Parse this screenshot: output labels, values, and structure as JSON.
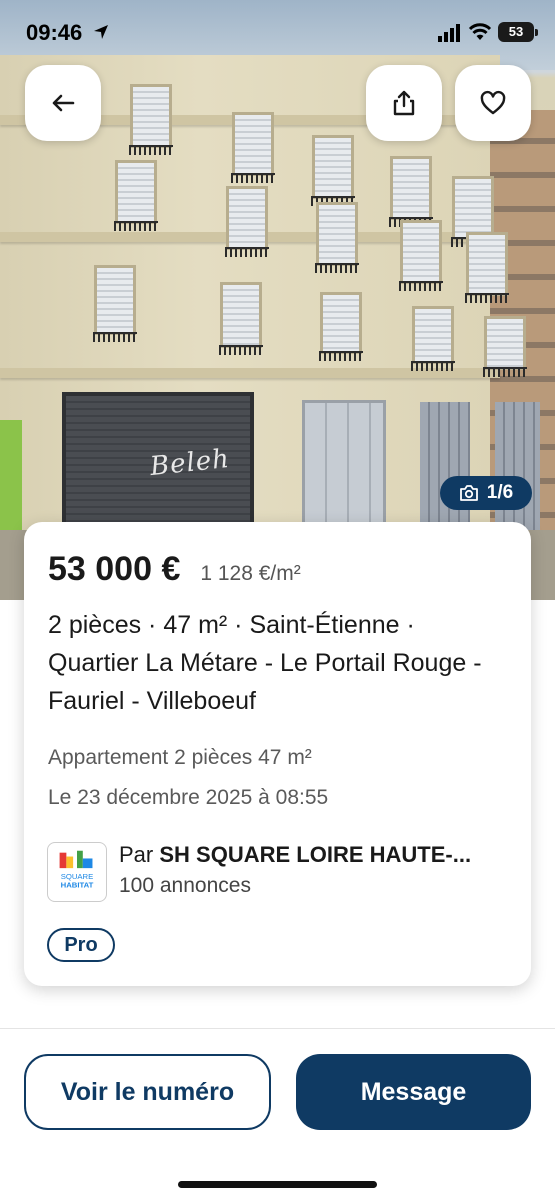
{
  "status_bar": {
    "time": "09:46",
    "battery": "53"
  },
  "photo": {
    "counter": "1/6",
    "graffiti": "Beleh"
  },
  "listing": {
    "price": "53 000 €",
    "price_per_m2": "1 128 €/m²",
    "title": "2 pièces · 47 m² · Saint-Étienne · Quartier La Métare - Le Portail Rouge - Fauriel - Villeboeuf",
    "subtitle": "Appartement 2 pièces 47 m²",
    "date": "Le 23 décembre 2025 à 08:55"
  },
  "agency": {
    "by_prefix": "Par",
    "name": "SH SQUARE LOIRE HAUTE-...",
    "count": "100 annonces",
    "logo_line1": "SQUARE",
    "logo_line2": "HABITAT",
    "badge": "Pro"
  },
  "actions": {
    "call_label": "Voir le numéro",
    "message_label": "Message"
  },
  "icons": {
    "back": "arrow-left-icon",
    "share": "share-icon",
    "favorite": "heart-icon",
    "camera": "camera-icon"
  },
  "colors": {
    "primary": "#0f3a63"
  }
}
